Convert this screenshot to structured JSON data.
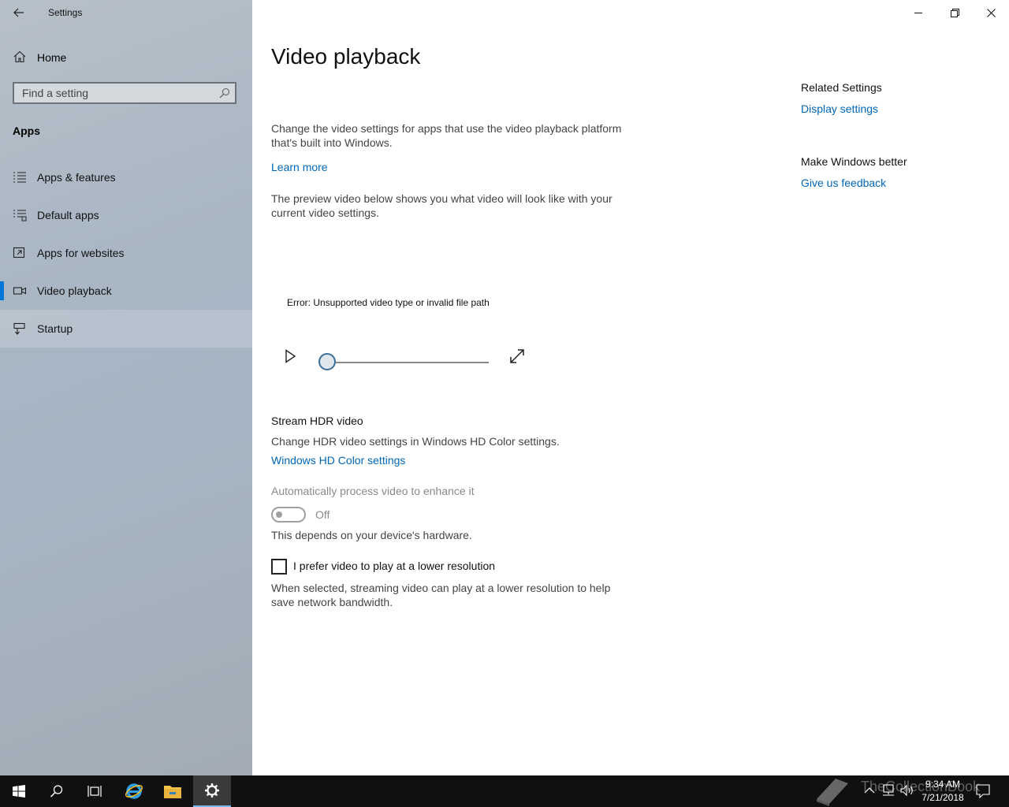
{
  "window": {
    "app_title": "Settings"
  },
  "sidebar": {
    "home_label": "Home",
    "search_placeholder": "Find a setting",
    "section_title": "Apps",
    "items": [
      {
        "label": "Apps & features",
        "icon": "list-icon"
      },
      {
        "label": "Default apps",
        "icon": "default-apps-icon"
      },
      {
        "label": "Apps for websites",
        "icon": "open-external-icon"
      },
      {
        "label": "Video playback",
        "icon": "video-camera-icon",
        "selected": true
      },
      {
        "label": "Startup",
        "icon": "startup-icon"
      }
    ]
  },
  "main": {
    "title": "Video playback",
    "intro": "Change the video settings for apps that use the video playback platform that's built into Windows.",
    "learn_more": "Learn more",
    "preview_text": "The preview video below shows you what video will look like with your current video settings.",
    "error_text": "Error: Unsupported video type or invalid file path",
    "hdr_heading": "Stream HDR video",
    "hdr_desc": "Change HDR video settings in Windows HD Color settings.",
    "hdr_link": "Windows HD Color settings",
    "auto_process_label": "Automatically process video to enhance it",
    "auto_process_state": "Off",
    "auto_process_note": "This depends on your device's hardware.",
    "lower_res_label": "I prefer video to play at a lower resolution",
    "lower_res_checked": false,
    "lower_res_desc": "When selected, streaming video can play at a lower resolution to help save network bandwidth."
  },
  "related": {
    "heading": "Related Settings",
    "display_link": "Display settings",
    "feedback_heading": "Make Windows better",
    "feedback_link": "Give us feedback"
  },
  "taskbar": {
    "time": "9:34 AM",
    "date": "7/21/2018",
    "watermark": "TheCollectionBook",
    "accent_color": "#76b9ed"
  },
  "colors": {
    "accent": "#0078d7",
    "link": "#0067b8"
  }
}
